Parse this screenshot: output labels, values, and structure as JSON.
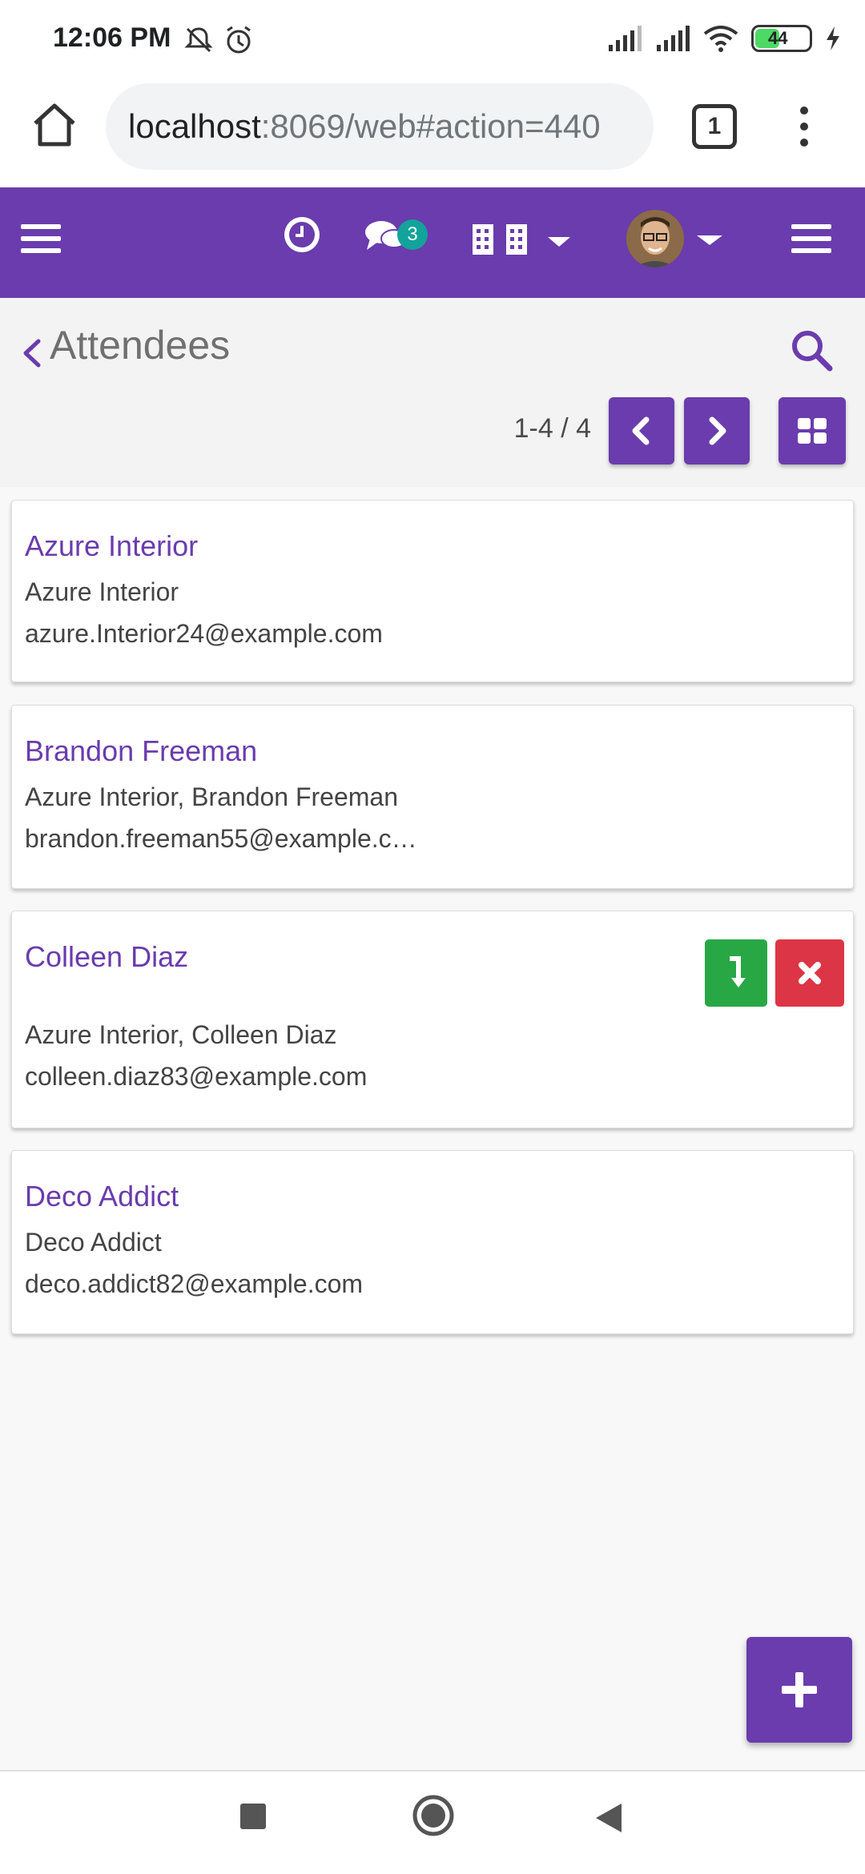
{
  "status_bar": {
    "time": "12:06 PM",
    "battery": "44"
  },
  "browser": {
    "url_host": "localhost",
    "url_path": ":8069/web#action=440",
    "tab_count": "1"
  },
  "navbar": {
    "messages_badge": "3"
  },
  "control_panel": {
    "title": "Attendees",
    "pager": "1-4 / 4"
  },
  "attendees": [
    {
      "name": "Azure Interior",
      "company": "Azure Interior",
      "email": "azure.Interior24@example.com"
    },
    {
      "name": "Brandon Freeman",
      "company": "Azure Interior, Brandon Freeman",
      "email": "brandon.freeman55@example.c…"
    },
    {
      "name": "Colleen Diaz",
      "company": "Azure Interior, Colleen Diaz",
      "email": "colleen.diaz83@example.com"
    },
    {
      "name": "Deco Addict",
      "company": "Deco Addict",
      "email": "deco.addict82@example.com"
    }
  ],
  "colors": {
    "primary": "#6a3cad",
    "accept": "#28a745",
    "decline": "#dc3545",
    "badge": "#12a39a"
  },
  "icons": {
    "back": "chevron-left-icon",
    "search": "search-icon",
    "prev": "chevron-left-icon",
    "next": "chevron-right-icon",
    "view": "kanban-grid-icon",
    "fab": "plus-icon"
  }
}
